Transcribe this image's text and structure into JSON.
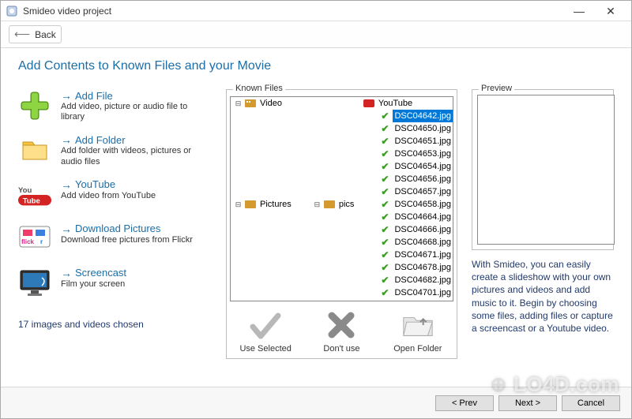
{
  "window": {
    "title": "Smideo video project",
    "minimize": "—",
    "close": "✕"
  },
  "toolbar": {
    "back_label": "Back"
  },
  "page": {
    "title": "Add Contents to Known Files and your Movie"
  },
  "actions": {
    "add_file": {
      "title": "Add File",
      "sub": "Add video, picture or audio file to library"
    },
    "add_folder": {
      "title": "Add Folder",
      "sub": "Add folder with videos, pictures or audio files"
    },
    "youtube": {
      "title": "YouTube",
      "sub": "Add video from YouTube"
    },
    "download_pics": {
      "title": "Download Pictures",
      "sub": "Download free pictures from Flickr"
    },
    "screencast": {
      "title": "Screencast",
      "sub": "Film your screen"
    }
  },
  "chosen_text": "17 images and videos chosen",
  "knownfiles": {
    "legend": "Known Files",
    "tree": {
      "video": "Video",
      "youtube": "YouTube",
      "pictures": "Pictures",
      "pics": "pics"
    },
    "files": [
      "DSC04642.jpg",
      "DSC04650.jpg",
      "DSC04651.jpg",
      "DSC04653.jpg",
      "DSC04654.jpg",
      "DSC04656.jpg",
      "DSC04657.jpg",
      "DSC04658.jpg",
      "DSC04664.jpg",
      "DSC04666.jpg",
      "DSC04668.jpg",
      "DSC04671.jpg",
      "DSC04678.jpg",
      "DSC04682.jpg",
      "DSC04701.jpg"
    ],
    "selected_index": 0
  },
  "midbuttons": {
    "use": "Use Selected",
    "dont": "Don't use",
    "open": "Open Folder"
  },
  "preview": {
    "legend": "Preview"
  },
  "description": "With Smideo, you can easily create a slideshow with your own pictures and videos and add music to it. Begin by choosing some files, adding files or capture a screencast or a Youtube video.",
  "footer": {
    "prev": "< Prev",
    "next": "Next >",
    "cancel": "Cancel"
  },
  "watermark": "LO4D.com"
}
